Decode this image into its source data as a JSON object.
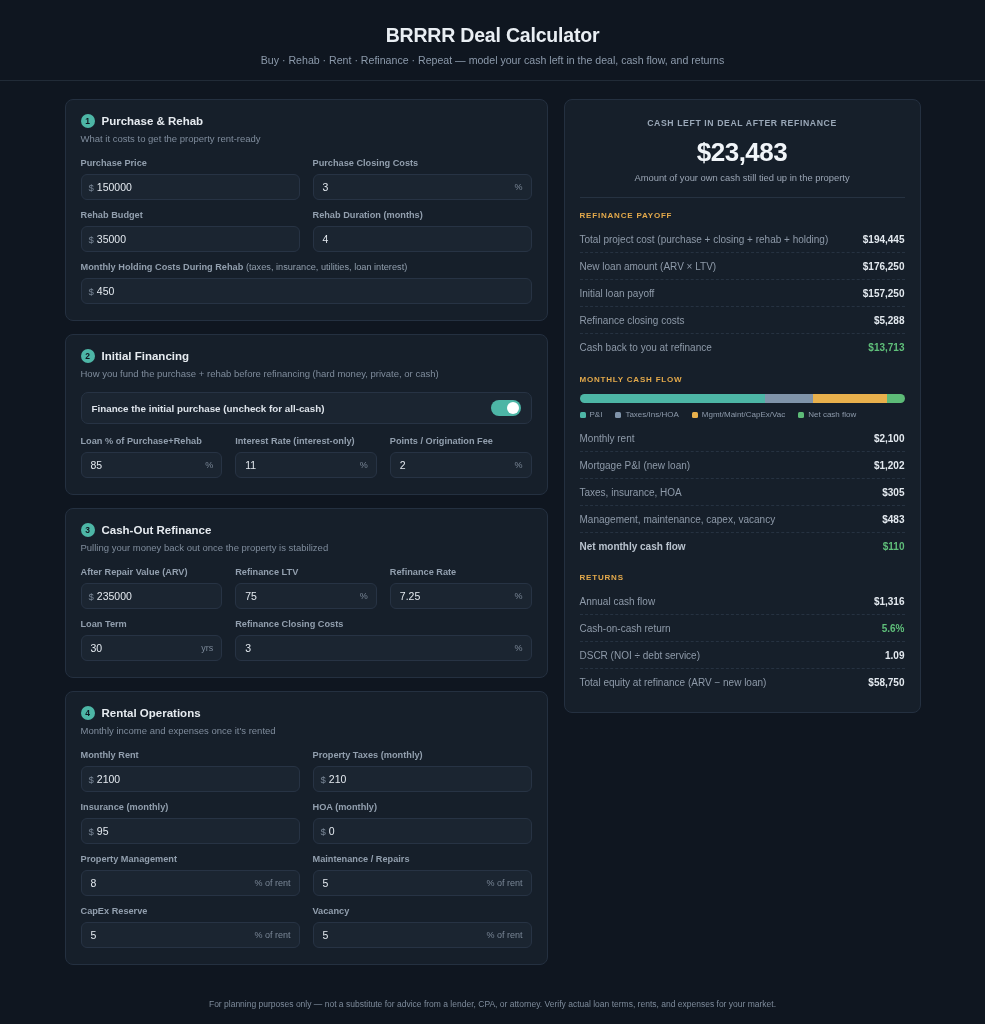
{
  "header": {
    "title": "BRRRR Deal Calculator",
    "subtitle": "Buy · Rehab · Rent · Refinance · Repeat — model your cash left in the deal, cash flow, and returns"
  },
  "sections": [
    {
      "number": "1",
      "title": "Purchase & Rehab",
      "subtitle": "What it costs to get the property rent-ready",
      "fields": [
        {
          "label": "Purchase Price",
          "prefix": "$",
          "value": "150000"
        },
        {
          "label": "Purchase Closing Costs",
          "value": "3",
          "suffix": "%"
        },
        {
          "label": "Rehab Budget",
          "prefix": "$",
          "value": "35000"
        },
        {
          "label": "Rehab Duration (months)",
          "value": "4"
        },
        {
          "label": "Monthly Holding Costs During Rehab",
          "hint": "(taxes, insurance, utilities, loan interest)",
          "prefix": "$",
          "value": "450"
        }
      ]
    },
    {
      "number": "2",
      "title": "Initial Financing",
      "subtitle": "How you fund the purchase + rehab before refinancing (hard money, private, or cash)",
      "toggle": {
        "label": "Finance the initial purchase (uncheck for all-cash)",
        "on": true
      },
      "fields": [
        {
          "label": "Loan % of Purchase+Rehab",
          "value": "85",
          "suffix": "%"
        },
        {
          "label": "Interest Rate (interest-only)",
          "value": "11",
          "suffix": "%"
        },
        {
          "label": "Points / Origination Fee",
          "value": "2",
          "suffix": "%"
        }
      ]
    },
    {
      "number": "3",
      "title": "Cash-Out Refinance",
      "subtitle": "Pulling your money back out once the property is stabilized",
      "fields": [
        {
          "label": "After Repair Value (ARV)",
          "prefix": "$",
          "value": "235000"
        },
        {
          "label": "Refinance LTV",
          "value": "75",
          "suffix": "%"
        },
        {
          "label": "Refinance Rate",
          "value": "7.25",
          "suffix": "%"
        },
        {
          "label": "Loan Term",
          "value": "30",
          "suffix": "yrs"
        },
        {
          "label": "Refinance Closing Costs",
          "value": "3",
          "suffix": "%"
        }
      ]
    },
    {
      "number": "4",
      "title": "Rental Operations",
      "subtitle": "Monthly income and expenses once it's rented",
      "fields": [
        {
          "label": "Monthly Rent",
          "prefix": "$",
          "value": "2100"
        },
        {
          "label": "Property Taxes (monthly)",
          "prefix": "$",
          "value": "210"
        },
        {
          "label": "Insurance (monthly)",
          "prefix": "$",
          "value": "95"
        },
        {
          "label": "HOA (monthly)",
          "prefix": "$",
          "value": "0"
        },
        {
          "label": "Property Management",
          "value": "8",
          "suffix": "% of rent"
        },
        {
          "label": "Maintenance / Repairs",
          "value": "5",
          "suffix": "% of rent"
        },
        {
          "label": "CapEx Reserve",
          "value": "5",
          "suffix": "% of rent"
        },
        {
          "label": "Vacancy",
          "value": "5",
          "suffix": "% of rent"
        }
      ]
    }
  ],
  "summary": {
    "label": "CASH LEFT IN DEAL AFTER REFINANCE",
    "amount": "$23,483",
    "caption": "Amount of your own cash still tied up in the property"
  },
  "refinance_payoff": {
    "heading": "REFINANCE PAYOFF",
    "rows": [
      {
        "label": "Total project cost (purchase + closing + rehab + holding)",
        "value": "$194,445",
        "highlight": false
      },
      {
        "label": "New loan amount (ARV × LTV)",
        "value": "$176,250",
        "highlight": false
      },
      {
        "label": "Initial loan payoff",
        "value": "$157,250",
        "highlight": false
      },
      {
        "label": "Refinance closing costs",
        "value": "$5,288",
        "highlight": false
      },
      {
        "label": "Cash back to you at refinance",
        "value": "$13,713",
        "highlight": true
      }
    ]
  },
  "monthly_cash_flow": {
    "heading": "MONTHLY CASH FLOW",
    "legend": [
      {
        "label": "P&I",
        "color": "#4db6a6"
      },
      {
        "label": "Taxes/Ins/HOA",
        "color": "#8094aa"
      },
      {
        "label": "Mgmt/Maint/CapEx/Vac",
        "color": "#e8b04c"
      },
      {
        "label": "Net cash flow",
        "color": "#5dbb77"
      }
    ],
    "rows": [
      {
        "label": "Monthly rent",
        "value": "$2,100",
        "highlight": false,
        "total": false
      },
      {
        "label": "Mortgage P&I (new loan)",
        "value": "$1,202",
        "highlight": false,
        "total": false
      },
      {
        "label": "Taxes, insurance, HOA",
        "value": "$305",
        "highlight": false,
        "total": false
      },
      {
        "label": "Management, maintenance, capex, vacancy",
        "value": "$483",
        "highlight": false,
        "total": false
      },
      {
        "label": "Net monthly cash flow",
        "value": "$110",
        "highlight": true,
        "total": true
      }
    ]
  },
  "returns": {
    "heading": "RETURNS",
    "rows": [
      {
        "label": "Annual cash flow",
        "value": "$1,316",
        "highlight": false
      },
      {
        "label": "Cash-on-cash return",
        "value": "5.6%",
        "highlight": true
      },
      {
        "label": "DSCR (NOI ÷ debt service)",
        "value": "1.09",
        "highlight": false
      },
      {
        "label": "Total equity at refinance (ARV − new loan)",
        "value": "$58,750",
        "highlight": false
      }
    ]
  },
  "footer": "For planning purposes only — not a substitute for advice from a lender, CPA, or attorney. Verify actual loan terms, rents, and expenses for your market."
}
